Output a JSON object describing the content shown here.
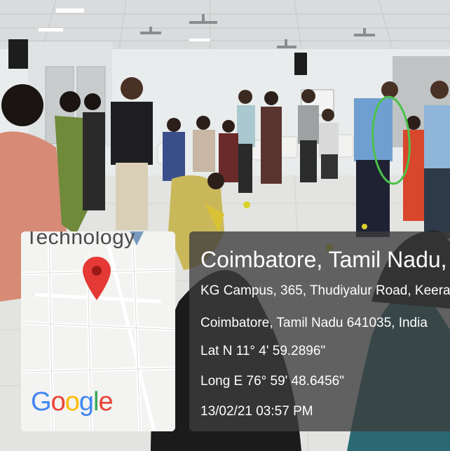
{
  "map": {
    "partial_label": "Technology",
    "logo": [
      "G",
      "o",
      "o",
      "g",
      "l",
      "e"
    ],
    "logo_colors": [
      "#4285F4",
      "#EA4335",
      "#FBBC05",
      "#4285F4",
      "#34A853",
      "#EA4335"
    ],
    "pin_color": "#E53935"
  },
  "location": {
    "title": "Coimbatore, Tamil Nadu, In",
    "address_line1": "KG Campus, 365, Thudiyalur Road, Keera",
    "address_line2": "Coimbatore, Tamil Nadu 641035, India",
    "latitude": "Lat N 11° 4' 59.2896\"",
    "longitude": "Long E 76° 59' 48.6456\"",
    "timestamp": "13/02/21 03:57 PM"
  },
  "colors": {
    "hoop": "#4CC24A",
    "panel": "rgba(60,60,60,0.78)"
  }
}
